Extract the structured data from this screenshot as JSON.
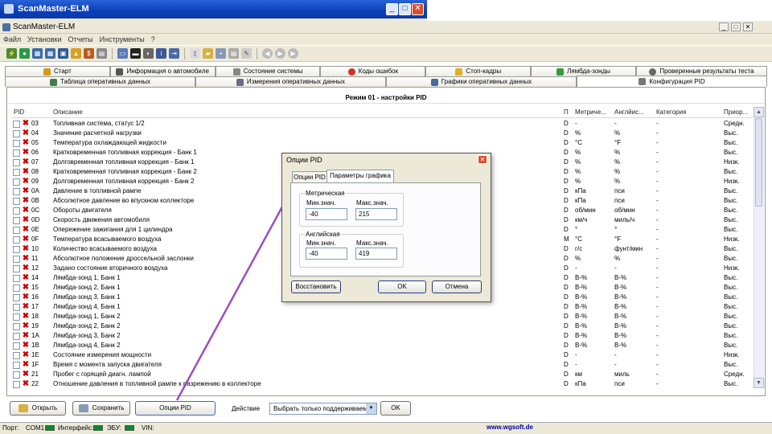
{
  "outer_window": {
    "title": "ScanMaster-ELM"
  },
  "inner_window": {
    "title": "ScanMaster-ELM"
  },
  "menu": [
    "Файл",
    "Установки",
    "Отчеты",
    "Инструменты",
    "?"
  ],
  "tabs_row1": [
    {
      "label": "Старт",
      "icon": "start-icon",
      "color": "#d69a1a"
    },
    {
      "label": "Информация о автомобиле",
      "icon": "info-icon",
      "color": "#555555"
    },
    {
      "label": "Состояние системы",
      "icon": "system-status-icon",
      "color": "#888888"
    },
    {
      "label": "Коды ошибок",
      "icon": "error-codes-icon",
      "color": "#d03030"
    },
    {
      "label": "Стоп-кадры",
      "icon": "freeze-frame-icon",
      "color": "#e0b020"
    },
    {
      "label": "Лямбда-зонды",
      "icon": "lambda-icon",
      "color": "#3a9a3a"
    },
    {
      "label": "Проверенные результаты теста",
      "icon": "test-results-icon",
      "color": "#666666"
    }
  ],
  "tabs_row2": [
    {
      "label": "Таблица оперативных данных",
      "icon": "table-icon",
      "color": "#4a7a4a"
    },
    {
      "label": "Измерения оперативных данных",
      "icon": "gauge-icon",
      "color": "#6a6a8a"
    },
    {
      "label": "Графики оперативных данных",
      "icon": "graph-icon",
      "color": "#4a6a9a"
    },
    {
      "label": "Конфигурация PID",
      "icon": "config-icon",
      "color": "#777777"
    }
  ],
  "panel_title": "Режим 01 - настройки PID",
  "columns": {
    "pid": "PID",
    "desc": "Описание",
    "p": "П",
    "metric": "Метриче...",
    "english": "Англйис...",
    "category": "Категория",
    "priority": "Приор..."
  },
  "rows": [
    [
      "03",
      "Топливная система, статус 1/2",
      "D",
      "-",
      "-",
      "-",
      "Средн."
    ],
    [
      "04",
      "Значение расчетной нагрузки",
      "D",
      "%",
      "%",
      "-",
      "Выс."
    ],
    [
      "05",
      "Температура охлаждающей жидкости",
      "D",
      "°C",
      "°F",
      "-",
      "Выс."
    ],
    [
      "06",
      "Кратковременная топливная коррекция - Банк 1",
      "D",
      "%",
      "%",
      "-",
      "Выс."
    ],
    [
      "07",
      "Долговременная топливная коррекция - Банк 1",
      "D",
      "%",
      "%",
      "-",
      "Низк."
    ],
    [
      "08",
      "Кратковременная топливная коррекция - Банк 2",
      "D",
      "%",
      "%",
      "-",
      "Выс."
    ],
    [
      "09",
      "Долговременная топливная коррекция - Банк 2",
      "D",
      "%",
      "%",
      "-",
      "Низк."
    ],
    [
      "0A",
      "Давление в топливной рампе",
      "D",
      "кПа",
      "пси",
      "-",
      "Выс."
    ],
    [
      "0B",
      "Абсолютное давление во впускном коллекторе",
      "D",
      "кПа",
      "пси",
      "-",
      "Выс."
    ],
    [
      "0C",
      "Обороты двигателя",
      "D",
      "об/мин",
      "об/мин",
      "-",
      "Выс."
    ],
    [
      "0D",
      "Скорость движения автомобиля",
      "D",
      "км/ч",
      "миль/ч",
      "-",
      "Выс."
    ],
    [
      "0E",
      "Опережение зажигания для 1 цилиндра",
      "D",
      "°",
      "°",
      "-",
      "Выс."
    ],
    [
      "0F",
      "Температура всасываемого воздуха",
      "M",
      "°C",
      "°F",
      "-",
      "Низк."
    ],
    [
      "10",
      "Количество всасываемого воздуха",
      "D",
      "г/с",
      "фунт/мин",
      "-",
      "Выс."
    ],
    [
      "11",
      "Абсолютное положение дроссельной заслонки",
      "D",
      "%",
      "%",
      "-",
      "Выс."
    ],
    [
      "12",
      "Задано состояние вторичного воздуха",
      "D",
      "-",
      "-",
      "-",
      "Низк."
    ],
    [
      "14",
      "Лямбда-зонд 1, Банк 1",
      "D",
      "В-%",
      "В-%",
      "-",
      "Выс."
    ],
    [
      "15",
      "Лямбда-зонд 2, Банк 1",
      "D",
      "В-%",
      "В-%",
      "-",
      "Выс."
    ],
    [
      "16",
      "Лямбда-зонд 3, Банк 1",
      "D",
      "В-%",
      "В-%",
      "-",
      "Выс."
    ],
    [
      "17",
      "Лямбда-зонд 4, Банк 1",
      "D",
      "В-%",
      "В-%",
      "-",
      "Выс."
    ],
    [
      "18",
      "Лямбда-зонд 1, Банк 2",
      "D",
      "В-%",
      "В-%",
      "-",
      "Выс."
    ],
    [
      "19",
      "Лямбда-зонд 2, Банк 2",
      "D",
      "В-%",
      "В-%",
      "-",
      "Выс."
    ],
    [
      "1A",
      "Лямбда-зонд 3, Банк 2",
      "D",
      "В-%",
      "В-%",
      "-",
      "Выс."
    ],
    [
      "1B",
      "Лямбда-зонд 4, Банк 2",
      "D",
      "В-%",
      "В-%",
      "-",
      "Выс."
    ],
    [
      "1E",
      "Состояние измерения мощности",
      "D",
      "-",
      "-",
      "-",
      "Низк."
    ],
    [
      "1F",
      "Время с момента запуска двигателя",
      "D",
      "-",
      "-",
      "-",
      "Выс."
    ],
    [
      "21",
      "Пробег с горящей диагн. лампой",
      "D",
      "км",
      "миль",
      "-",
      "Средн."
    ],
    [
      "22",
      "Отношение давления в топливной рампе к разрежению в коллекторе",
      "D",
      "кПа",
      "пси",
      "-",
      "Выс."
    ]
  ],
  "buttons": {
    "open": "Открыть",
    "save": "Сохранить",
    "pid_options": "Опции PID"
  },
  "action_label": "Действие",
  "action_select": "Выбрать только поддерживаем",
  "ok_main": "OK",
  "status": {
    "port_label": "Порт:",
    "port": "COM1",
    "interface": "Интерфейс:",
    "ecu": "ЭБУ:",
    "vin": "VIN:",
    "url": "www.wgsoft.de"
  },
  "dialog": {
    "title": "Опции PID",
    "tab1": "Опции PID",
    "tab2": "Параметры графика",
    "metric_group": "Метрическая",
    "english_group": "Английская",
    "min_label": "Мин.знач.",
    "max_label": "Макс.знач.",
    "metric_min": "-40",
    "metric_max": "215",
    "english_min": "-40",
    "english_max": "419",
    "restore": "Восстановить",
    "ok": "OK",
    "cancel": "Отмена"
  },
  "colors": {
    "accent_arrow": "#9b4fc0",
    "xp_title": "#0a3fb8",
    "led": "#0a8a2a"
  }
}
